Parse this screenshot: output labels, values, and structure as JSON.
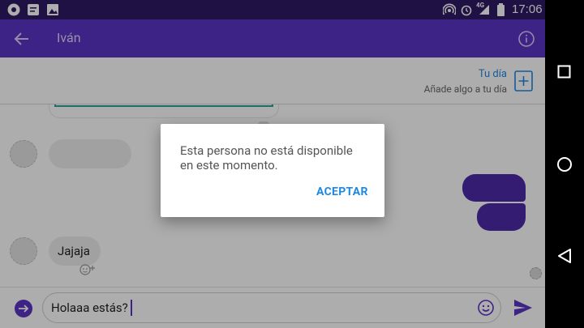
{
  "status_bar": {
    "time": "17:06",
    "network": "4G",
    "icons": [
      "app-icon",
      "messages-icon",
      "image-icon",
      "hotspot-icon",
      "alarm-icon",
      "signal-icon",
      "battery-icon"
    ]
  },
  "app_bar": {
    "title": "Iván",
    "back_icon": "arrow-back-icon",
    "info_icon": "info-icon"
  },
  "story": {
    "title": "Tu día",
    "subtitle": "Añade algo a tu día",
    "add_icon": "add-box-icon"
  },
  "messages": [
    {
      "from": "contact",
      "text": "Jajaja"
    }
  ],
  "composer": {
    "value": "Holaaa estás?",
    "emoji_icon": "emoji-icon",
    "send_icon": "send-icon",
    "expand_icon": "arrow-right-circle-icon"
  },
  "dialog": {
    "message": "Esta persona no está disponible en este momento.",
    "line1": "Esta persona no está disponible",
    "line2": "en este momento.",
    "accept_label": "ACEPTAR"
  },
  "nav": {
    "icons": [
      "overview-square-icon",
      "home-circle-icon",
      "back-triangle-icon"
    ]
  },
  "colors": {
    "brand": "#5b34c4",
    "status_bar": "#2e1a63",
    "accent_blue": "#1e88e5",
    "bubble_purple": "#4d2aa8"
  }
}
